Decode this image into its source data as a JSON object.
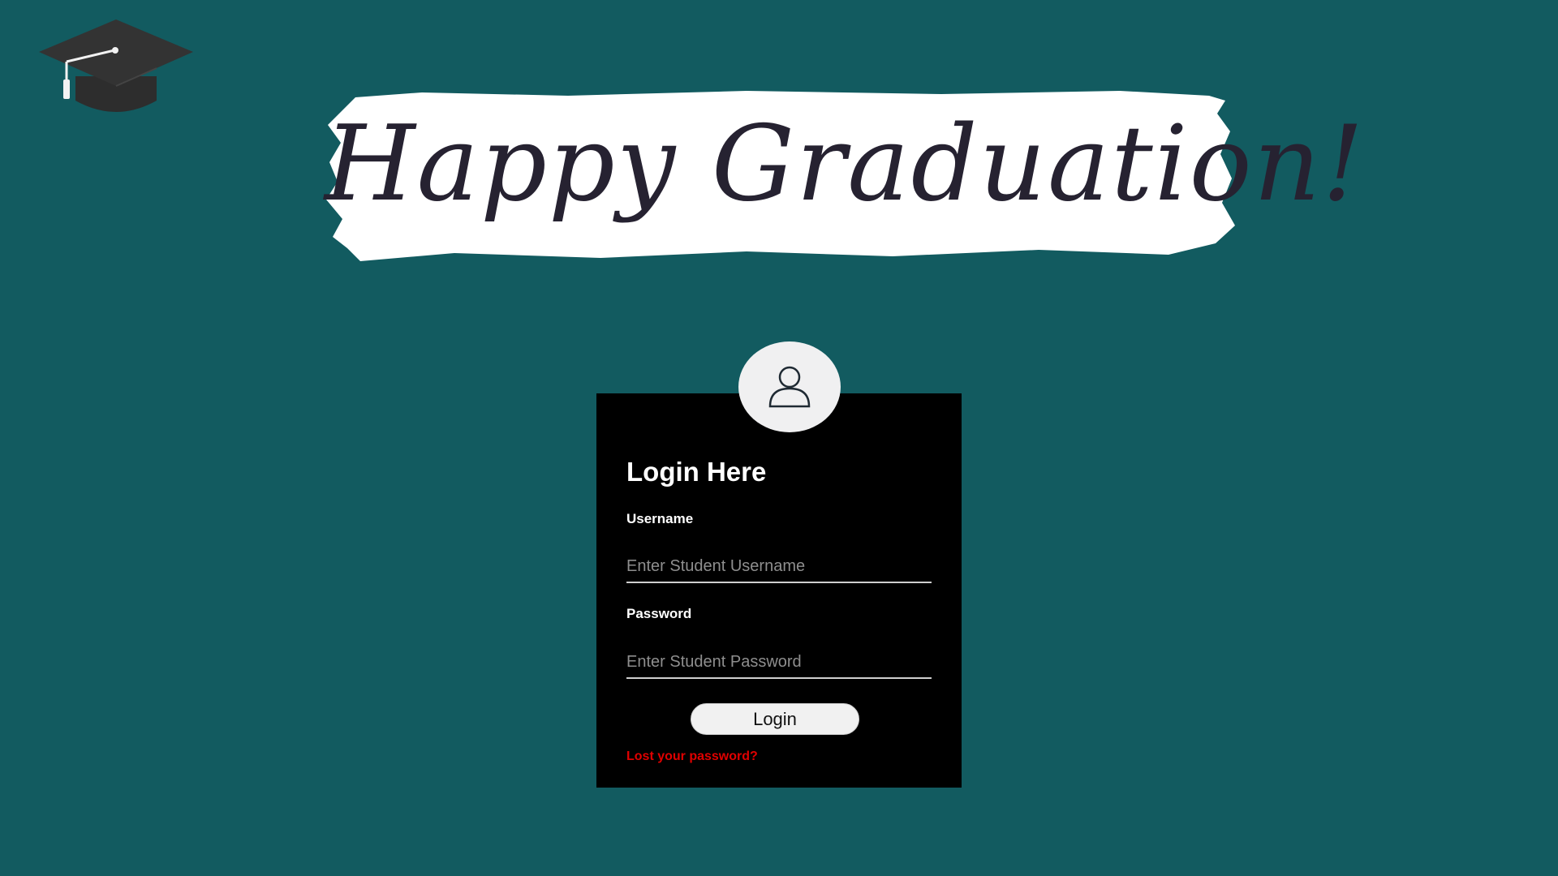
{
  "header": {
    "logo_icon": "graduation-cap-icon",
    "banner_title": "Happy Graduation!"
  },
  "login": {
    "avatar_icon": "user-icon",
    "title": "Login Here",
    "username_label": "Username",
    "username_placeholder": "Enter Student Username",
    "password_label": "Password",
    "password_placeholder": "Enter Student Password",
    "login_button": "Login",
    "lost_password_link": "Lost your password?"
  },
  "colors": {
    "background": "#125b60",
    "card": "#000000",
    "link": "#e00000",
    "banner": "#ffffff"
  }
}
